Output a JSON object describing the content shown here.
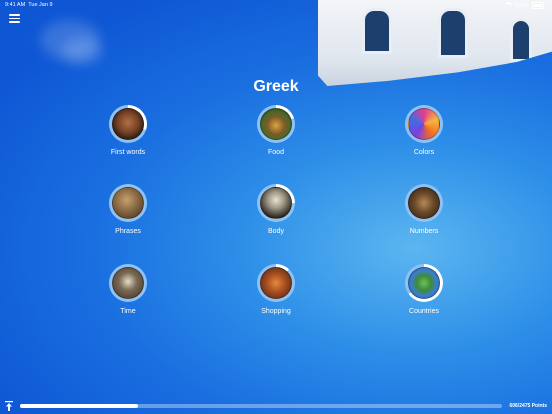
{
  "status": {
    "time": "9:41 AM",
    "date": "Tue Jan 9",
    "battery": "100%"
  },
  "header": {
    "menu_icon": "hamburger-menu-icon",
    "title": "Greek"
  },
  "categories": [
    {
      "label": "First words",
      "progress": 0.3,
      "image": "child-face"
    },
    {
      "label": "Food",
      "progress": 0.2,
      "image": "burger"
    },
    {
      "label": "Colors",
      "progress": 0.0,
      "image": "color-splash"
    },
    {
      "label": "Phrases",
      "progress": 0.0,
      "image": "person-phrases"
    },
    {
      "label": "Body",
      "progress": 0.25,
      "image": "skeleton"
    },
    {
      "label": "Numbers",
      "progress": 0.0,
      "image": "number-dials"
    },
    {
      "label": "Time",
      "progress": 0.0,
      "image": "alarm-clock"
    },
    {
      "label": "Shopping",
      "progress": 0.12,
      "image": "shopping-bags"
    },
    {
      "label": "Countries",
      "progress": 0.65,
      "image": "world-map"
    }
  ],
  "footer": {
    "points": "606/2475 Points",
    "progress": 0.245
  },
  "colors": {
    "ring_fill": "#ffffff",
    "ring_track": "#8ec2f5"
  }
}
